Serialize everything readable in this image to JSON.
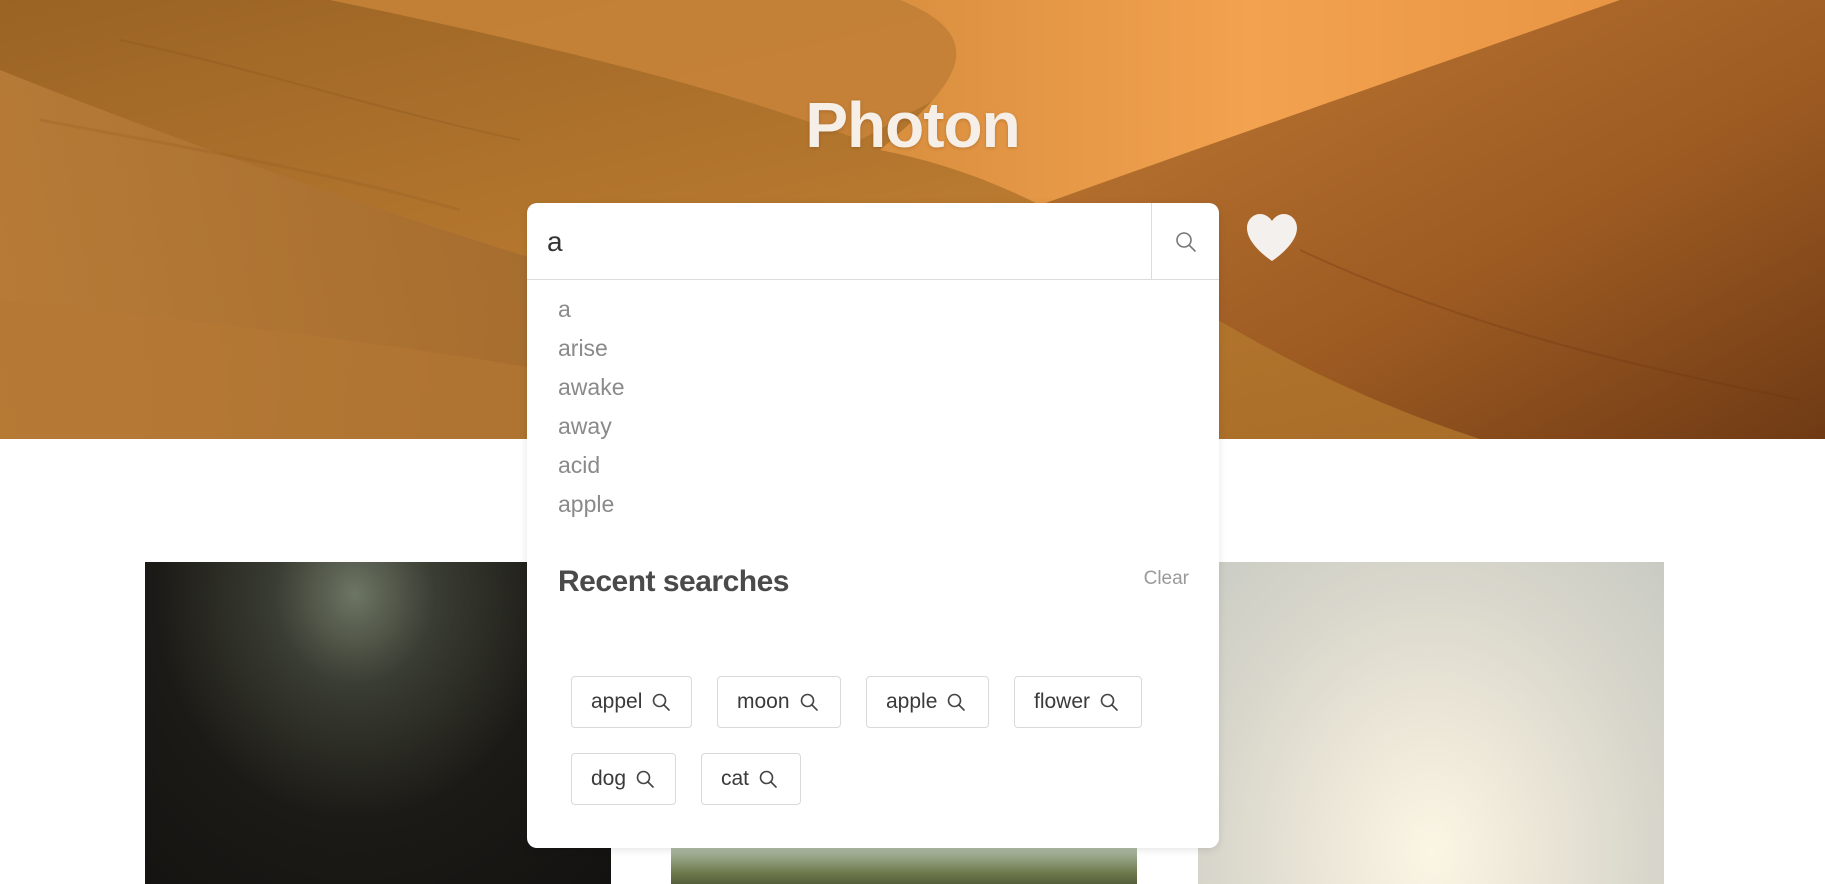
{
  "app": {
    "title": "Photon"
  },
  "search": {
    "value": "a",
    "placeholder": ""
  },
  "suggestions": [
    "a",
    "arise",
    "awake",
    "away",
    "acid",
    "apple"
  ],
  "recent": {
    "title": "Recent searches",
    "clear_label": "Clear",
    "items": [
      "appel",
      "moon",
      "apple",
      "flower",
      "dog",
      "cat"
    ]
  },
  "icons": {
    "search_button": "search-icon",
    "favorites_button": "heart-icon",
    "chip_icon": "search-icon"
  },
  "colors": {
    "title": "#f5efe8",
    "heart": "#f3f0ee",
    "suggestion_text": "#8a8a8a",
    "recent_title": "#4a4a4a",
    "chip_border": "#d9d9d9"
  }
}
